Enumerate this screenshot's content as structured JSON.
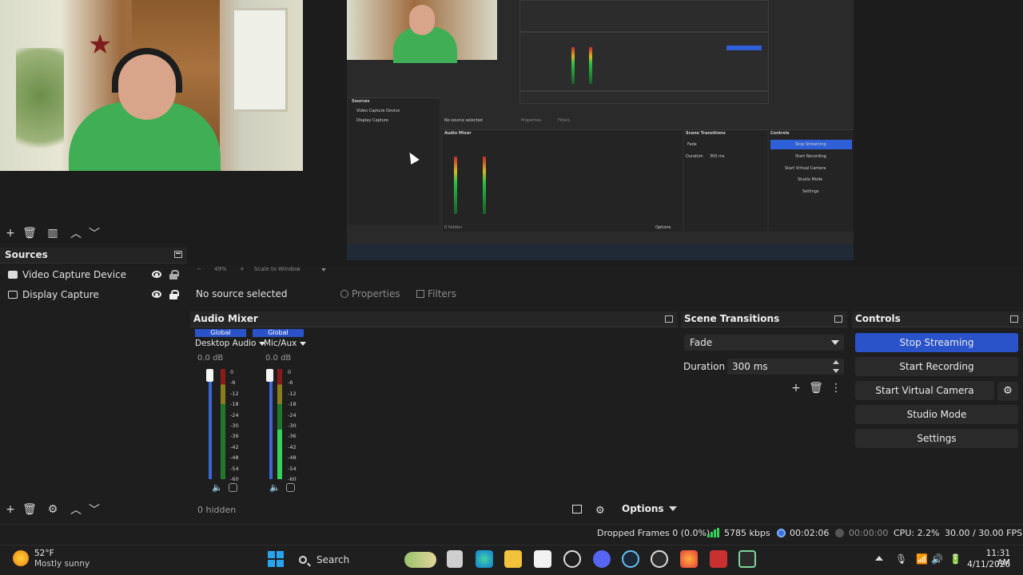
{
  "preview": {
    "nested_mini_sources": [
      "Video Capture Device",
      "Display Capture"
    ],
    "nested_mini_no_source": "No source selected",
    "nested_mini_audio_title": "Audio Mixer",
    "nested_mini_transitions_title": "Scene Transitions",
    "nested_mini_controls_title": "Controls",
    "nested_mini_fade": "Fade",
    "nested_mini_duration": "Duration",
    "nested_mini_duration_value": "300 ms",
    "nested_mini_buttons": [
      "Stop Streaming",
      "Start Recording",
      "Start Virtual Camera",
      "Studio Mode",
      "Settings"
    ],
    "nested_mini_sources_title": "Sources",
    "nested_mini_properties": "Properties",
    "nested_mini_filters": "Filters",
    "nested_mini_hidden": "0 hidden",
    "nested_mini_options": "Options"
  },
  "scale_bar": {
    "zoom": "49%",
    "mode": "Scale to Window"
  },
  "sources": {
    "title": "Sources",
    "items": [
      {
        "label": "Video Capture Device",
        "icon": "camera-icon",
        "visible": true,
        "locked": false
      },
      {
        "label": "Display Capture",
        "icon": "monitor-icon",
        "visible": true,
        "locked": true
      }
    ]
  },
  "context": {
    "no_source": "No source selected",
    "properties": "Properties",
    "filters": "Filters"
  },
  "audio_mixer": {
    "title": "Audio Mixer",
    "channels": [
      {
        "global": "Global",
        "name": "Desktop Audio",
        "db": "0.0 dB"
      },
      {
        "global": "Global",
        "name": "Mic/Aux",
        "db": "0.0 dB"
      }
    ],
    "ticks": [
      "0",
      "-6",
      "-12",
      "-18",
      "-24",
      "-30",
      "-36",
      "-42",
      "-48",
      "-54",
      "-60"
    ],
    "hidden": "0 hidden",
    "options": "Options"
  },
  "transitions": {
    "title": "Scene Transitions",
    "selected": "Fade",
    "duration_label": "Duration",
    "duration_value": "300 ms"
  },
  "controls": {
    "title": "Controls",
    "stop_streaming": "Stop Streaming",
    "start_recording": "Start Recording",
    "start_virtual_camera": "Start Virtual Camera",
    "studio_mode": "Studio Mode",
    "settings": "Settings"
  },
  "status": {
    "dropped_frames": "Dropped Frames 0 (0.0%)",
    "bitrate": "5785 kbps",
    "stream_time": "00:02:06",
    "record_time": "00:00:00",
    "cpu": "CPU: 2.2%",
    "fps": "30.00 / 30.00 FPS"
  },
  "taskbar": {
    "weather_temp": "52°F",
    "weather_cond": "Mostly sunny",
    "search": "Search",
    "time": "11:31 AM",
    "date": "4/11/2026"
  },
  "colors": {
    "accent": "#2b53c9",
    "panel_bg": "#1e1e1e",
    "meter_green": "#35d35a"
  }
}
